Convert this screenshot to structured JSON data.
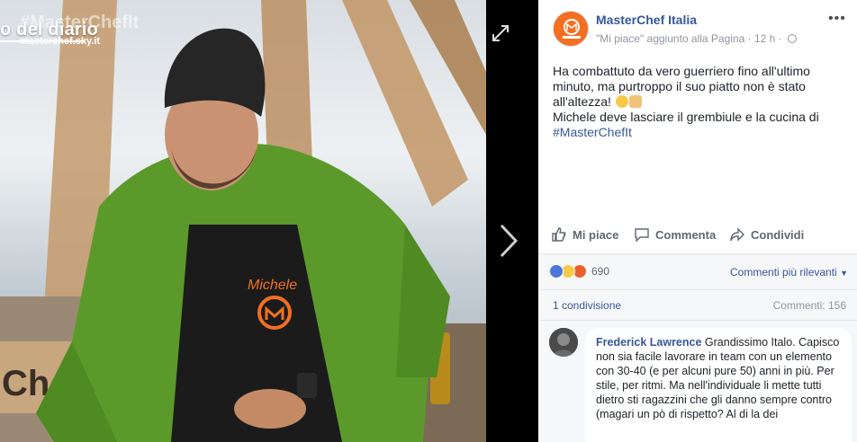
{
  "viewer": {
    "overlay_caption": "o del diario",
    "overlay_hashtag": "#MasterChefIt",
    "overlay_url": "masterchef.sky.it",
    "apron_name": "Michele"
  },
  "post": {
    "page_name": "MasterChef Italia",
    "meta_like": "\"Mi piace\" aggiunto alla Pagina",
    "meta_sep": "·",
    "meta_time": "12 h",
    "meta_sep2": "·",
    "more_label": "•••",
    "text_line1": "Ha combattuto da vero guerriero fino all'ultimo minuto, ma purtroppo il suo piatto non è stato all'altezza!",
    "text_line2": "Michele deve lasciare il grembiule e la cucina di",
    "hashtag": "#MasterChefIt",
    "emojis": [
      "sad-face",
      "clapping-hands"
    ]
  },
  "actions": {
    "like": "Mi piace",
    "comment": "Commenta",
    "share": "Condividi"
  },
  "stats": {
    "reaction_icons": [
      "like-reaction",
      "sad-reaction",
      "angry-reaction"
    ],
    "reaction_count": "690",
    "sort_label": "Commenti più rilevanti",
    "shares": "1 condivisione",
    "comments": "Commenti: 156"
  },
  "comment": {
    "author": "Frederick Lawrence",
    "text": "Grandissimo Italo. Capisco non sia facile lavorare in team con un elemento con 30-40 (e per alcuni pure 50) anni in più. Per stile, per ritmi. Ma nell'individuale li mette tutti dietro sti ragazzini che gli danno sempre contro (magari un pò di rispetto? Al di la dei"
  },
  "colors": {
    "link": "#365899",
    "brand_orange": "#f36f21",
    "text": "#1d2129",
    "muted": "#90949c"
  }
}
